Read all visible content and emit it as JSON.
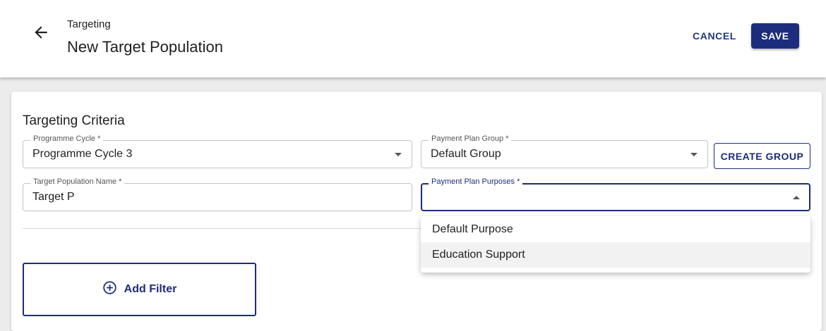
{
  "header": {
    "breadcrumb": "Targeting",
    "title": "New Target Population",
    "cancel_label": "CANCEL",
    "save_label": "SAVE"
  },
  "criteria": {
    "section_title": "Targeting Criteria",
    "programme_cycle": {
      "label": "Programme Cycle *",
      "value": "Programme Cycle 3"
    },
    "payment_plan_group": {
      "label": "Payment Plan Group *",
      "value": "Default Group"
    },
    "create_group_label": "CREATE GROUP",
    "target_population_name": {
      "label": "Target Population Name *",
      "value": "Target P"
    },
    "payment_plan_purposes": {
      "label": "Payment Plan Purposes *",
      "value": "",
      "options": [
        "Default Purpose",
        "Education Support"
      ],
      "highlighted_option": "Education Support"
    },
    "add_filter_label": "Add Filter"
  },
  "icons": {
    "back": "arrow-left-icon",
    "dropdown": "chevron-down-icon",
    "add": "plus-circle-icon"
  },
  "colors": {
    "primary": "#1d2c7c",
    "background": "#ececec"
  }
}
